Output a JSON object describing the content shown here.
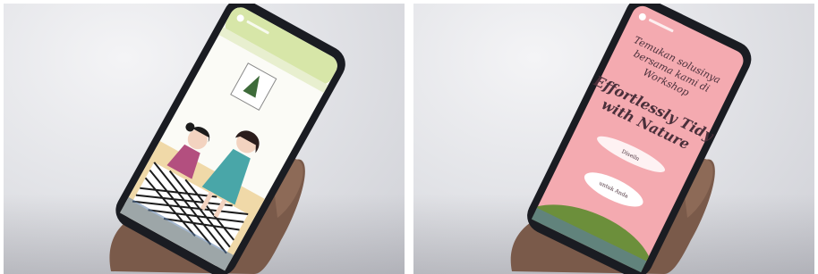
{
  "images": [
    {
      "name": "phone-storybook-illustration",
      "screen": {
        "header_bar_color": "#d7e6a8",
        "wall_color": "#fbfbf6",
        "rug_colors": [
          "#ffffff",
          "#1c1c1c",
          "#f2b8c6"
        ]
      }
    },
    {
      "name": "phone-workshop-poster",
      "screen": {
        "background_color": "#f4aab0",
        "heading_lines": [
          "Temukan solusinya",
          "bersama kami di",
          "Workshop"
        ],
        "title_lines": [
          "Effortlessly Tidy",
          "with Nature"
        ],
        "sub_lines": [
          "Diseiln",
          "untuk Anda"
        ]
      }
    }
  ]
}
